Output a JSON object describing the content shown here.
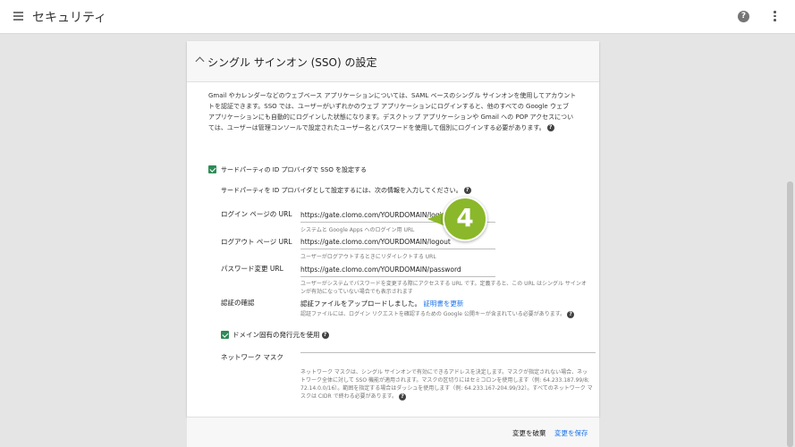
{
  "header": {
    "title": "セキュリティ",
    "help_icon": "?"
  },
  "panel": {
    "title": "シングル サインオン (SSO) の設定",
    "description_lines": [
      "Gmail やカレンダーなどのウェブベース アプリケーションについては、SAML ベースのシングル サインオンを使用してアカウント",
      "トを認証できます。SSO では、ユーザーがいずれかのウェブ アプリケーションにログインすると、他のすべての Google ウェブ",
      "アプリケーションにも自動的にログインした状態になります。デスクトップ アプリケーションや Gmail への POP アクセスについ",
      "ては、ユーザーは管理コンソールで設定されたユーザー名とパスワードを使用して個別にログインする必要があります。"
    ],
    "sso_checkbox_label": "サードパーティの ID プロバイダで SSO を設定する",
    "idp_intro": "サードパーティを ID プロバイダとして設定するには、次の情報を入力してください。",
    "login_url": {
      "label": "ログイン ページの URL",
      "value": "https://gate.clomo.com/YOURDOMAIN/login",
      "hint": "システムと Google Apps へのログイン用 URL"
    },
    "logout_url": {
      "label": "ログアウト ページ URL",
      "value": "https://gate.clomo.com/YOURDOMAIN/logout",
      "hint": "ユーザーがログアウトするときにリダイレクトする URL"
    },
    "password_url": {
      "label": "パスワード変更 URL",
      "value": "https://gate.clomo.com/YOURDOMAIN/password",
      "hint_lines": [
        "ユーザーがシステムでパスワードを変更する際にアクセスする URL です。定義すると、この URL はシングル サインオ",
        "ンが有効になっていない場合でも表示されます"
      ]
    },
    "verify": {
      "label": "認証の確認",
      "status": "認証ファイルをアップロードしました。",
      "update_link": "証明書を更新",
      "hint": "認証ファイルには、ログイン リクエストを確認するための Google 公開キーが含まれている必要があります。"
    },
    "domain_issuer_label": "ドメイン固有の発行元を使用",
    "network_mask": {
      "label": "ネットワーク マスク",
      "hint_lines": [
        "ネットワーク マスクは、シングル サインオンで有効にできるアドレスを決定します。マスクが指定されない場合、ネッ",
        "トワーク全体に対して SSO 機能が適用されます。マスクの区切りにはセミコロンを使用します（例: 64.233.187.99/8;",
        "72.14.0.0/16）。範囲を指定する場合はダッシュを使用します（例: 64.233.167-204.99/32）。すべてのネットワーク マ",
        "スクは CIDR で終わる必要があります。"
      ]
    }
  },
  "footer": {
    "discard_label": "変更を破棄",
    "save_label": "変更を保存"
  },
  "annotation": {
    "step_number": "4"
  },
  "colors": {
    "accent": "#1a73e8",
    "checkbox": "#2e8b57",
    "step_badge": "#8ab82a"
  }
}
